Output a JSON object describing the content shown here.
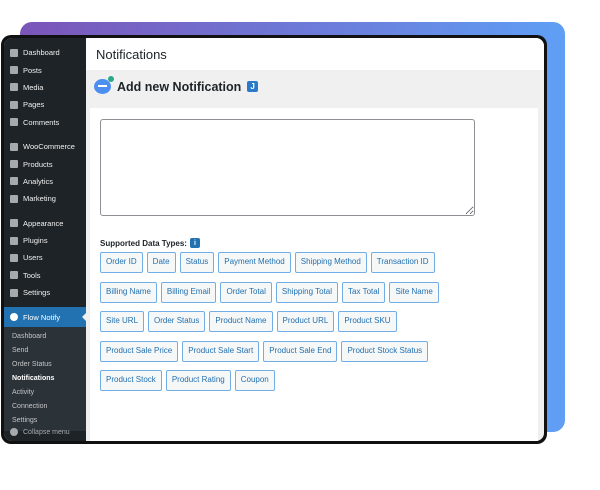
{
  "sidebar": {
    "items": [
      "Dashboard",
      "Posts",
      "Media",
      "Pages",
      "Comments",
      "WooCommerce",
      "Products",
      "Analytics",
      "Marketing",
      "Appearance",
      "Plugins",
      "Users",
      "Tools",
      "Settings"
    ],
    "active": "Flow Notify",
    "submenu": [
      "Dashboard",
      "Send",
      "Order Status",
      "Notifications",
      "Activity",
      "Connection",
      "Settings"
    ],
    "collapse": "Collapse menu"
  },
  "header": {
    "title": "Notifications"
  },
  "panel": {
    "title": "Add new Notification",
    "badge": "J",
    "textarea": "",
    "types_label": "Supported Data Types:",
    "info": "i",
    "tags": [
      "Order ID",
      "Date",
      "Status",
      "Payment Method",
      "Shipping Method",
      "Transaction ID",
      "Billing Name",
      "Billing Email",
      "Order Total",
      "Shipping Total",
      "Tax Total",
      "Site Name",
      "Site URL",
      "Order Status",
      "Product Name",
      "Product URL",
      "Product SKU",
      "Product Sale Price",
      "Product Sale Start",
      "Product Sale End",
      "Product Stock Status",
      "Product Stock",
      "Product Rating",
      "Coupon"
    ]
  }
}
